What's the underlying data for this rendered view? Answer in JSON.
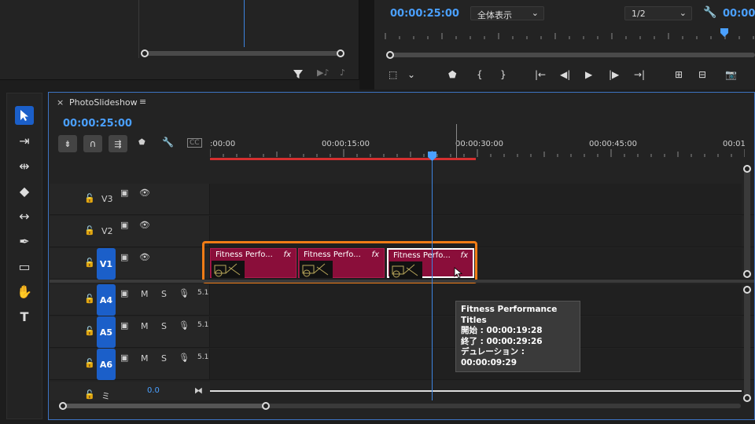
{
  "program_monitor": {
    "timecode": "00:00:25:00",
    "fit_label": "全体表示",
    "resolution_label": "1/2",
    "right_timecode": "00:00"
  },
  "sequence": {
    "name": "PhotoSlideshow",
    "timecode": "00:00:25:00",
    "ruler_labels": [
      ":00:00",
      "00:00:15:00",
      "00:00:30:00",
      "00:00:45:00",
      "00:01"
    ]
  },
  "tracks": {
    "video": [
      {
        "label": "V3",
        "active": false
      },
      {
        "label": "V2",
        "active": false
      },
      {
        "label": "V1",
        "active": true
      }
    ],
    "audio": [
      {
        "label": "A4",
        "m": "M",
        "s": "S",
        "extra": "5.1"
      },
      {
        "label": "A5",
        "m": "M",
        "s": "S",
        "extra": "5.1"
      },
      {
        "label": "A6",
        "m": "M",
        "s": "S",
        "extra": "5.1"
      }
    ],
    "master_value": "0.0",
    "master_label": "ミ"
  },
  "clips": [
    {
      "title": "Fitness Perfo...",
      "fx": "fx"
    },
    {
      "title": "Fitness Perfo...",
      "fx": "fx"
    },
    {
      "title": "Fitness Perfo...",
      "fx": "fx"
    }
  ],
  "tooltip": {
    "title": "Fitness Performance Titles",
    "start": "開始 : 00:00:19:28",
    "end": "終了 : 00:00:29:26",
    "duration": "デュレーション : 00:00:09:29"
  },
  "colors": {
    "accent": "#4aa0ff",
    "clip": "#8a0e3a",
    "highlight": "#f07c16",
    "track_active": "#1b5fc9",
    "inout_bar": "#d63030"
  }
}
